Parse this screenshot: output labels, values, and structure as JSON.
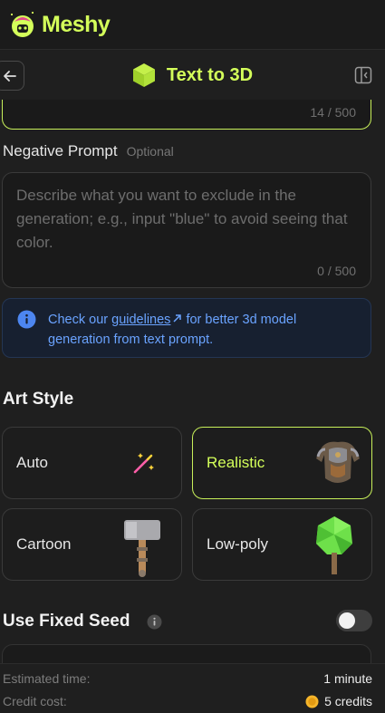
{
  "app": {
    "name": "Meshy"
  },
  "header": {
    "title": "Text to 3D",
    "title_icon": "cube-icon",
    "back_icon": "arrow-left-icon",
    "panel_icon": "sidebar-collapse-icon"
  },
  "prompt": {
    "counter": "14 / 500"
  },
  "negative_prompt": {
    "label": "Negative Prompt",
    "optional": "Optional",
    "placeholder": "Describe what you want to exclude in the generation; e.g., input \"blue\" to avoid seeing that color.",
    "counter": "0 / 500"
  },
  "info": {
    "prefix": "Check our ",
    "link": "guidelines",
    "link_icon": "external-link-icon",
    "suffix": " for better 3d model generation from text prompt."
  },
  "art_style": {
    "title": "Art Style",
    "options": [
      {
        "label": "Auto",
        "image": "magic-wand-icon",
        "selected": false
      },
      {
        "label": "Realistic",
        "image": "armor-image",
        "selected": true
      },
      {
        "label": "Cartoon",
        "image": "hammer-image",
        "selected": false
      },
      {
        "label": "Low-poly",
        "image": "tree-image",
        "selected": false
      }
    ]
  },
  "seed": {
    "title": "Use Fixed Seed",
    "enabled": false
  },
  "footer": {
    "time_label": "Estimated time:",
    "time_value": "1 minute",
    "credit_label": "Credit cost:",
    "credit_value": "5 credits",
    "credit_icon": "coin-icon"
  },
  "colors": {
    "accent": "#d4ff5a",
    "link": "#6aa3ff",
    "background": "#1f1f1f"
  }
}
